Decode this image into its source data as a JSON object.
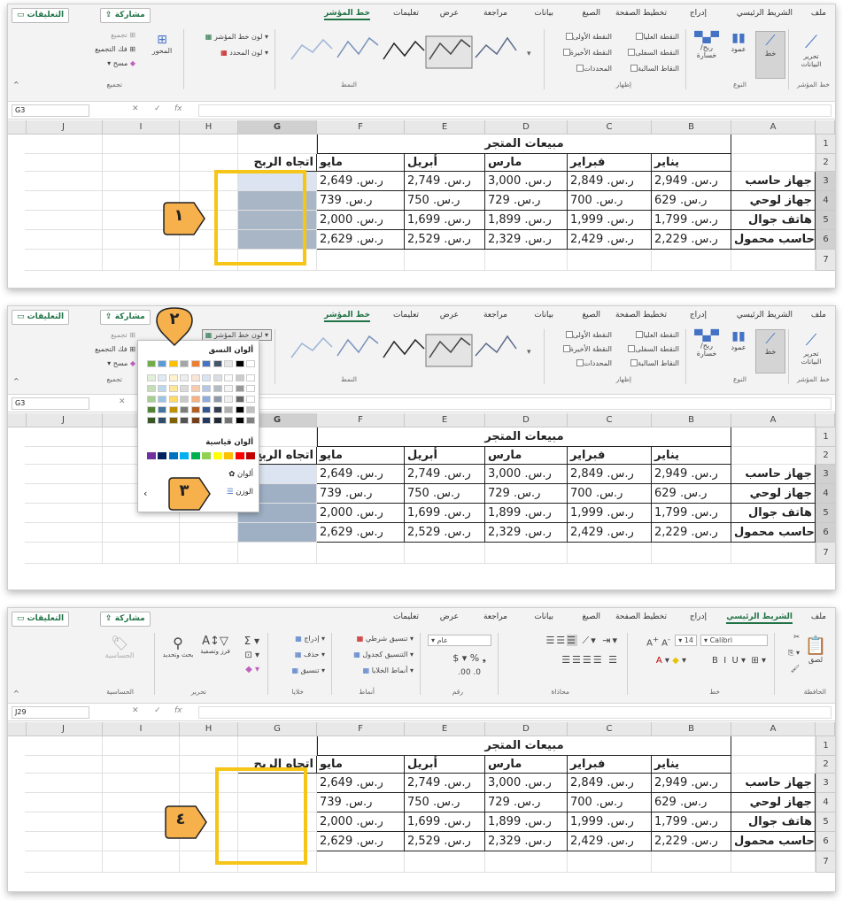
{
  "ribbon_sparkline": {
    "tabs": [
      "ملف",
      "الشريط الرئيسي",
      "إدراج",
      "تخطيط الصفحة",
      "الصيغ",
      "بيانات",
      "مراجعة",
      "عرض",
      "تعليمات",
      "خط المؤشر"
    ],
    "share": "مشاركة",
    "comments": "التعليقات",
    "group_sparkline": "خط المؤشر",
    "edit_data": "تحرير البيانات",
    "group_type": "النوع",
    "type_line": "خط",
    "type_column": "عمود",
    "type_winloss": "ربح/ خسارة",
    "group_show": "إظهار",
    "high_point": "النقطة العليا",
    "first_point": "النقطة الأولى",
    "low_point": "النقطة السفلى",
    "last_point": "النقطة الأخيرة",
    "negative_points": "النقاط السالبة",
    "markers": "المحددات",
    "group_style": "النمط",
    "sparkline_color": "لون خط المؤشر",
    "marker_color": "لون المحدد",
    "axis": "المحور",
    "group_btn": "تجميع",
    "ungroup": "فك التجميع",
    "clear": "مسح",
    "group_group": "تجميع"
  },
  "ribbon_home": {
    "tabs": [
      "ملف",
      "الشريط الرئيسي",
      "إدراج",
      "تخطيط الصفحة",
      "الصيغ",
      "بيانات",
      "مراجعة",
      "عرض",
      "تعليمات"
    ],
    "paste": "لصق",
    "clipboard": "الحافظة",
    "font_name": "Calibri",
    "font_size": "14",
    "font": "خط",
    "alignment": "محاذاة",
    "number_format": "عام",
    "number": "رقم",
    "conditional_formatting": "تنسيق شرطي",
    "format_as_table": "التنسيق كجدول",
    "cell_styles": "أنماط الخلايا",
    "styles": "أنماط",
    "insert": "إدراج",
    "delete": "حذف",
    "format": "تنسيق",
    "cells": "خلايا",
    "sort_filter": "فرز وتصفية",
    "find_select": "بحث وتحديد",
    "editing": "تحرير",
    "sensitivity": "الحساسية",
    "sensitivity_grp": "الحساسية"
  },
  "fx": "fx",
  "panels": [
    {
      "namebox": "G3"
    },
    {
      "namebox": "G3"
    },
    {
      "namebox": "J29"
    }
  ],
  "columns": [
    "A",
    "B",
    "C",
    "D",
    "E",
    "F",
    "G",
    "H",
    "I",
    "J"
  ],
  "rows": [
    "1",
    "2",
    "3",
    "4",
    "5",
    "6",
    "7"
  ],
  "sheet": {
    "title": "مبيعات المتجر",
    "months": [
      "يناير",
      "فبراير",
      "مارس",
      "أبريل",
      "مايو"
    ],
    "trend_header": "اتجاه الربح",
    "products": [
      {
        "name": "جهاز حاسب",
        "values": [
          "ر.س. 2,949",
          "ر.س. 2,849",
          "ر.س. 3,000",
          "ر.س. 2,749",
          "ر.س. 2,649"
        ]
      },
      {
        "name": "جهاز لوحي",
        "values": [
          "ر.س. 629",
          "ر.س. 700",
          "ر.س. 729",
          "ر.س. 750",
          "ر.س. 739"
        ]
      },
      {
        "name": "هاتف جوال",
        "values": [
          "ر.س. 1,799",
          "ر.س. 1,999",
          "ر.س. 1,899",
          "ر.س. 1,699",
          "ر.س. 2,000"
        ]
      },
      {
        "name": "حاسب محمول",
        "values": [
          "ر.س. 2,229",
          "ر.س. 2,429",
          "ر.س. 2,329",
          "ر.س. 2,529",
          "ر.س. 2,629"
        ]
      }
    ]
  },
  "dropdown": {
    "theme_colors": "ألوان النسق",
    "standard_colors": "ألوان قياسية",
    "more_colors": "ألوان",
    "weight": "الوزن",
    "colors": {
      "theme_row": [
        "#ffffff",
        "#000000",
        "#e7e6e6",
        "#44546a",
        "#4472c4",
        "#ed7d31",
        "#a5a5a5",
        "#ffc000",
        "#5b9bd5",
        "#70ad47"
      ],
      "standard": [
        "#c00000",
        "#ff0000",
        "#ffc000",
        "#ffff00",
        "#92d050",
        "#00b050",
        "#00b0f0",
        "#0070c0",
        "#002060",
        "#7030a0"
      ]
    }
  },
  "badges": [
    "١",
    "٢",
    "٣",
    "٤"
  ],
  "colors": {
    "highlight": "#f5c518",
    "badge_fill": "#f6b04c",
    "spark_default": "#44546a",
    "spark_green": "#2ca02c",
    "excel_green": "#217346"
  }
}
